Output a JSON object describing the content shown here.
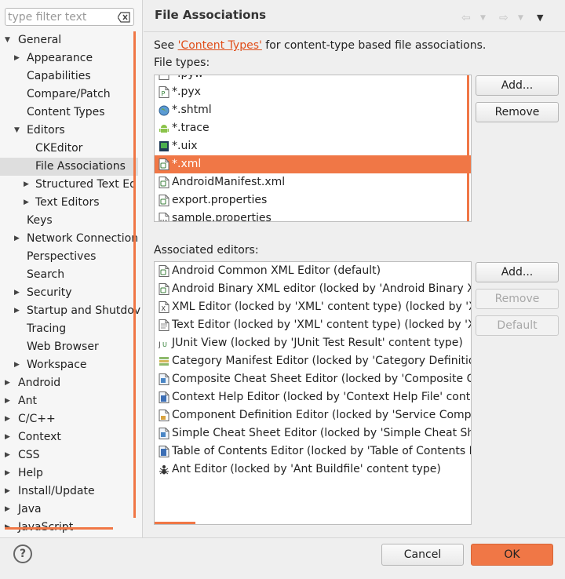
{
  "filter": {
    "placeholder": "type filter text"
  },
  "tree": [
    {
      "label": "General",
      "depth": 0,
      "twisty": "open"
    },
    {
      "label": "Appearance",
      "depth": 1,
      "twisty": "closed"
    },
    {
      "label": "Capabilities",
      "depth": 1,
      "twisty": "none"
    },
    {
      "label": "Compare/Patch",
      "depth": 1,
      "twisty": "none"
    },
    {
      "label": "Content Types",
      "depth": 1,
      "twisty": "none"
    },
    {
      "label": "Editors",
      "depth": 1,
      "twisty": "open"
    },
    {
      "label": "CKEditor",
      "depth": 2,
      "twisty": "none"
    },
    {
      "label": "File Associations",
      "depth": 2,
      "twisty": "none",
      "selected": true
    },
    {
      "label": "Structured Text Ed",
      "depth": 2,
      "twisty": "closed"
    },
    {
      "label": "Text Editors",
      "depth": 2,
      "twisty": "closed"
    },
    {
      "label": "Keys",
      "depth": 1,
      "twisty": "none"
    },
    {
      "label": "Network Connection",
      "depth": 1,
      "twisty": "closed"
    },
    {
      "label": "Perspectives",
      "depth": 1,
      "twisty": "none"
    },
    {
      "label": "Search",
      "depth": 1,
      "twisty": "none"
    },
    {
      "label": "Security",
      "depth": 1,
      "twisty": "closed"
    },
    {
      "label": "Startup and Shutdov",
      "depth": 1,
      "twisty": "closed"
    },
    {
      "label": "Tracing",
      "depth": 1,
      "twisty": "none"
    },
    {
      "label": "Web Browser",
      "depth": 1,
      "twisty": "none"
    },
    {
      "label": "Workspace",
      "depth": 1,
      "twisty": "closed"
    },
    {
      "label": "Android",
      "depth": 0,
      "twisty": "closed"
    },
    {
      "label": "Ant",
      "depth": 0,
      "twisty": "closed"
    },
    {
      "label": "C/C++",
      "depth": 0,
      "twisty": "closed"
    },
    {
      "label": "Context",
      "depth": 0,
      "twisty": "closed"
    },
    {
      "label": "CSS",
      "depth": 0,
      "twisty": "closed"
    },
    {
      "label": "Help",
      "depth": 0,
      "twisty": "closed"
    },
    {
      "label": "Install/Update",
      "depth": 0,
      "twisty": "closed"
    },
    {
      "label": "Java",
      "depth": 0,
      "twisty": "closed"
    },
    {
      "label": "JavaScript",
      "depth": 0,
      "twisty": "closed"
    }
  ],
  "page": {
    "title": "File Associations",
    "see_prefix": "See ",
    "see_link": "'Content Types'",
    "see_suffix": " for content-type based file associations.",
    "file_types_label": "File types:",
    "associated_label": "Associated editors:"
  },
  "file_types": [
    {
      "label": "*.pyw",
      "icon": "file-icon"
    },
    {
      "label": "*.pyx",
      "icon": "python-file-icon"
    },
    {
      "label": "*.shtml",
      "icon": "globe-icon"
    },
    {
      "label": "*.trace",
      "icon": "android-icon"
    },
    {
      "label": "*.uix",
      "icon": "uix-icon"
    },
    {
      "label": "*.xml",
      "icon": "xml-file-icon",
      "selected": true
    },
    {
      "label": "AndroidManifest.xml",
      "icon": "xml-file-icon"
    },
    {
      "label": "export.properties",
      "icon": "xml-file-icon"
    },
    {
      "label": "sample.properties",
      "icon": "binary-file-icon"
    }
  ],
  "editors": [
    {
      "label": "Android Common XML Editor (default)",
      "icon": "xml-file-icon"
    },
    {
      "label": "Android Binary XML editor (locked by 'Android Binary XM",
      "icon": "xml-file-icon"
    },
    {
      "label": "XML Editor (locked by 'XML' content type) (locked by 'XM",
      "icon": "xml-editor-icon"
    },
    {
      "label": "Text Editor (locked by 'XML' content type) (locked by 'XMl",
      "icon": "text-file-icon"
    },
    {
      "label": "JUnit View (locked by 'JUnit Test Result' content type)",
      "icon": "junit-icon"
    },
    {
      "label": "Category Manifest Editor (locked by 'Category Definition",
      "icon": "category-icon"
    },
    {
      "label": "Composite Cheat Sheet Editor (locked by 'Composite Che",
      "icon": "cheatsheet-icon"
    },
    {
      "label": "Context Help Editor (locked by 'Context Help File' conten",
      "icon": "help-file-icon"
    },
    {
      "label": "Component Definition Editor (locked by 'Service Compon",
      "icon": "component-icon"
    },
    {
      "label": "Simple Cheat Sheet Editor (locked by 'Simple Cheat Sheet",
      "icon": "cheatsheet-icon"
    },
    {
      "label": "Table of Contents Editor (locked by 'Table of Contents Fil",
      "icon": "toc-icon"
    },
    {
      "label": "Ant Editor (locked by 'Ant Buildfile' content type)",
      "icon": "ant-icon"
    }
  ],
  "buttons": {
    "ft_add": "Add...",
    "ft_remove": "Remove",
    "ed_add": "Add...",
    "ed_remove": "Remove",
    "ed_default": "Default",
    "cancel": "Cancel",
    "ok": "OK",
    "help": "?"
  },
  "colors": {
    "accent": "#f07746",
    "link": "#e04e1a"
  }
}
